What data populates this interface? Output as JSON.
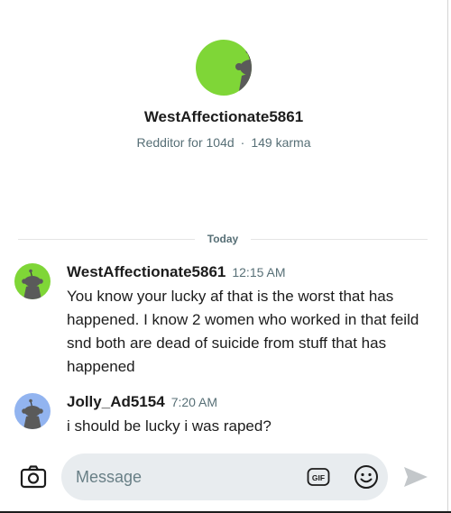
{
  "profile": {
    "username": "WestAffectionate5861",
    "age": "Redditor for 104d",
    "separator": "·",
    "karma": "149 karma"
  },
  "divider": {
    "label": "Today"
  },
  "messages": [
    {
      "author": "WestAffectionate5861",
      "time": "12:15 AM",
      "text": "You know your lucky af that is the worst that has happened. I know 2 women who worked in that feild snd both are dead of suicide from stuff that has happened",
      "avatar_color": "#7fd637"
    },
    {
      "author": "Jolly_Ad5154",
      "time": "7:20 AM",
      "text": "i should be lucky i was raped?",
      "avatar_color": "#92b4f0"
    }
  ],
  "composer": {
    "placeholder": "Message",
    "camera_icon": "camera-icon",
    "gif_icon": "gif-icon",
    "gif_label": "GIF",
    "emoji_icon": "emoji-icon",
    "send_icon": "send-icon"
  },
  "colors": {
    "avatar_green": "#7fd637",
    "avatar_blue": "#92b4f0",
    "meta_gray": "#576f76",
    "input_bg": "#e8ecef"
  }
}
